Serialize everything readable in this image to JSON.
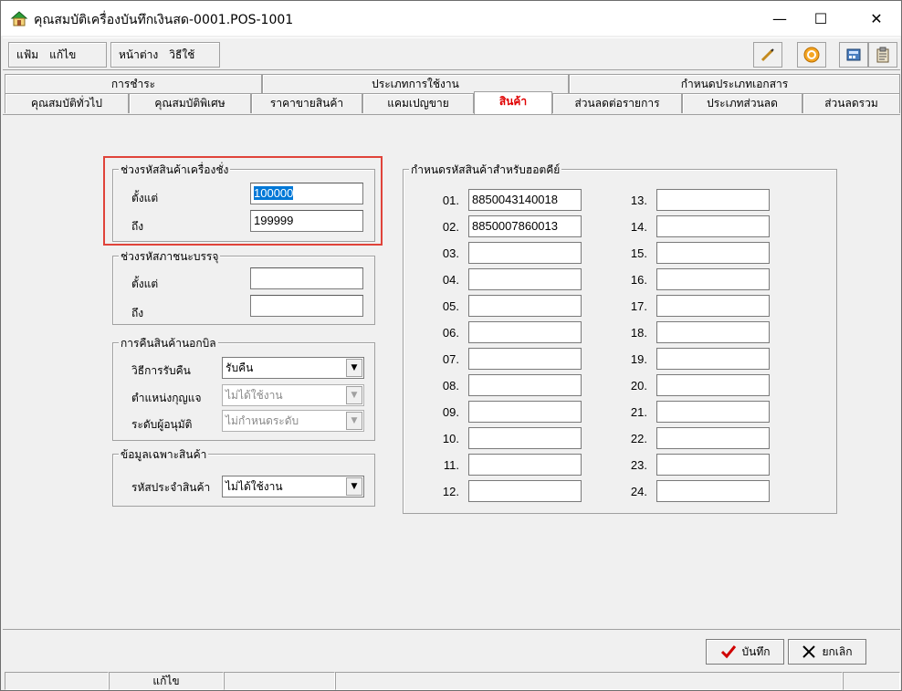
{
  "window": {
    "title": "คุณสมบัติเครื่องบันทึกเงินสด-0001.POS-1001",
    "minimize": "—",
    "maximize": "☐",
    "close": "✕"
  },
  "menu": {
    "file": "แฟ้ม",
    "edit": "แก้ไข",
    "window": "หน้าต่าง",
    "help": "วิธีใช้"
  },
  "tabs": {
    "row1": [
      "การชำระ",
      "ประเภทการใช้งาน",
      "กำหนดประเภทเอกสาร"
    ],
    "row2": [
      "คุณสมบัติทั่วไป",
      "คุณสมบัติพิเศษ",
      "ราคาขายสินค้า",
      "แคมเปญขาย",
      "สินค้า",
      "ส่วนลดต่อรายการ",
      "ประเภทส่วนลด",
      "ส่วนลดรวม"
    ],
    "active": "สินค้า"
  },
  "scale_code": {
    "title": "ช่วงรหัสสินค้าเครื่องชั่ง",
    "from_label": "ตั้งแต่",
    "from_value": "100000",
    "to_label": "ถึง",
    "to_value": "199999"
  },
  "package_code": {
    "title": "ช่วงรหัสภาชนะบรรจุ",
    "from_label": "ตั้งแต่",
    "from_value": "",
    "to_label": "ถึง",
    "to_value": ""
  },
  "return": {
    "title": "การคืนสินค้านอกบิล",
    "method_label": "วิธีการรับคืน",
    "method_value": "รับคืน",
    "key_label": "ตำแหน่งกุญแจ",
    "key_value": "ไม่ได้ใช้งาน",
    "level_label": "ระดับผู้อนุมัติ",
    "level_value": "ไม่กำหนดระดับ"
  },
  "product_info": {
    "title": "ข้อมูลเฉพาะสินค้า",
    "code_label": "รหัสประจำสินค้า",
    "code_value": "ไม่ได้ใช้งาน"
  },
  "hotkeys": {
    "title": "กำหนดรหัสสินค้าสำหรับฮอตคีย์",
    "left": [
      {
        "n": "01.",
        "v": "8850043140018"
      },
      {
        "n": "02.",
        "v": "8850007860013"
      },
      {
        "n": "03.",
        "v": ""
      },
      {
        "n": "04.",
        "v": ""
      },
      {
        "n": "05.",
        "v": ""
      },
      {
        "n": "06.",
        "v": ""
      },
      {
        "n": "07.",
        "v": ""
      },
      {
        "n": "08.",
        "v": ""
      },
      {
        "n": "09.",
        "v": ""
      },
      {
        "n": "10.",
        "v": ""
      },
      {
        "n": "11.",
        "v": ""
      },
      {
        "n": "12.",
        "v": ""
      }
    ],
    "right": [
      {
        "n": "13.",
        "v": ""
      },
      {
        "n": "14.",
        "v": ""
      },
      {
        "n": "15.",
        "v": ""
      },
      {
        "n": "16.",
        "v": ""
      },
      {
        "n": "17.",
        "v": ""
      },
      {
        "n": "18.",
        "v": ""
      },
      {
        "n": "19.",
        "v": ""
      },
      {
        "n": "20.",
        "v": ""
      },
      {
        "n": "21.",
        "v": ""
      },
      {
        "n": "22.",
        "v": ""
      },
      {
        "n": "23.",
        "v": ""
      },
      {
        "n": "24.",
        "v": ""
      }
    ]
  },
  "actions": {
    "save": "บันทึก",
    "cancel": "ยกเลิก"
  },
  "status": {
    "mode": "แก้ไข"
  },
  "colors": {
    "active_tab": "#e00000",
    "highlight_box": "#e0433a",
    "selection": "#0078d7"
  }
}
